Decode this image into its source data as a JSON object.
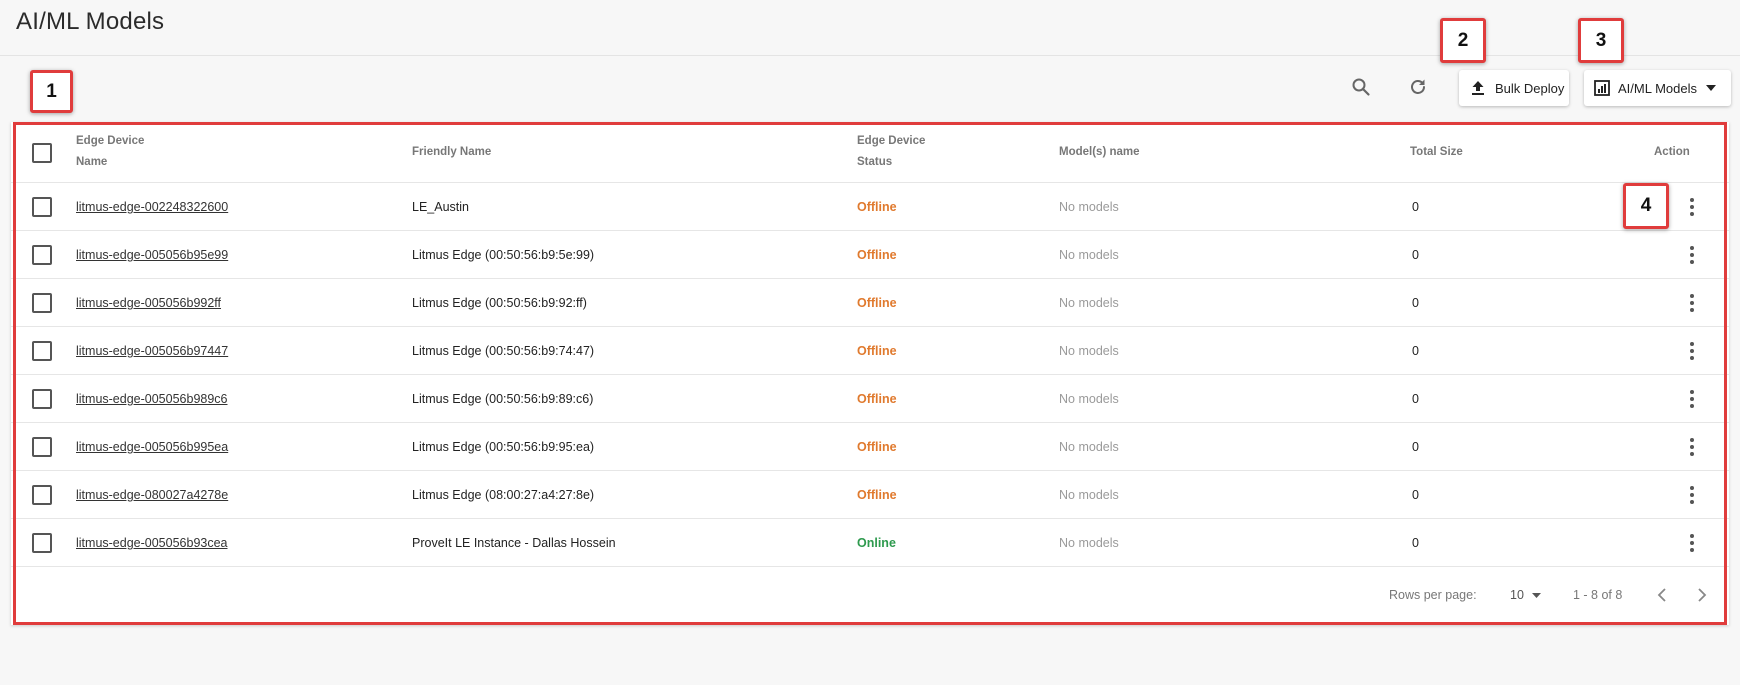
{
  "page": {
    "title": "AI/ML Models"
  },
  "toolbar": {
    "search_icon": "search-icon",
    "refresh_icon": "refresh-icon",
    "bulk_deploy_label": "Bulk Deploy",
    "bulk_deploy_icon": "upload-icon",
    "view_select_label": "AI/ML Models",
    "view_select_icon": "chart-icon"
  },
  "annotations": [
    "1",
    "2",
    "3",
    "4"
  ],
  "annotation_color": "#e03c3c",
  "table": {
    "headers": {
      "name_line1": "Edge Device",
      "name_line2": "Name",
      "friendly": "Friendly Name",
      "status_line1": "Edge Device",
      "status_line2": "Status",
      "models": "Model(s) name",
      "size": "Total Size",
      "action": "Action"
    },
    "rows": [
      {
        "name": "litmus-edge-002248322600",
        "friendly": "LE_Austin",
        "status": "Offline",
        "models": "No models",
        "size": "0"
      },
      {
        "name": "litmus-edge-005056b95e99",
        "friendly": "Litmus Edge (00:50:56:b9:5e:99)",
        "status": "Offline",
        "models": "No models",
        "size": "0"
      },
      {
        "name": "litmus-edge-005056b992ff",
        "friendly": "Litmus Edge (00:50:56:b9:92:ff)",
        "status": "Offline",
        "models": "No models",
        "size": "0"
      },
      {
        "name": "litmus-edge-005056b97447",
        "friendly": "Litmus Edge (00:50:56:b9:74:47)",
        "status": "Offline",
        "models": "No models",
        "size": "0"
      },
      {
        "name": "litmus-edge-005056b989c6",
        "friendly": "Litmus Edge (00:50:56:b9:89:c6)",
        "status": "Offline",
        "models": "No models",
        "size": "0"
      },
      {
        "name": "litmus-edge-005056b995ea",
        "friendly": "Litmus Edge (00:50:56:b9:95:ea)",
        "status": "Offline",
        "models": "No models",
        "size": "0"
      },
      {
        "name": "litmus-edge-080027a4278e",
        "friendly": "Litmus Edge (08:00:27:a4:27:8e)",
        "status": "Offline",
        "models": "No models",
        "size": "0"
      },
      {
        "name": "litmus-edge-005056b93cea",
        "friendly": "ProveIt LE Instance - Dallas Hossein",
        "status": "Online",
        "models": "No models",
        "size": "0"
      }
    ]
  },
  "status_colors": {
    "Offline": "#e07a2e",
    "Online": "#2e9a4e"
  },
  "pagination": {
    "rows_per_page_label": "Rows per page:",
    "rows_per_page_value": "10",
    "range": "1 - 8 of 8"
  }
}
